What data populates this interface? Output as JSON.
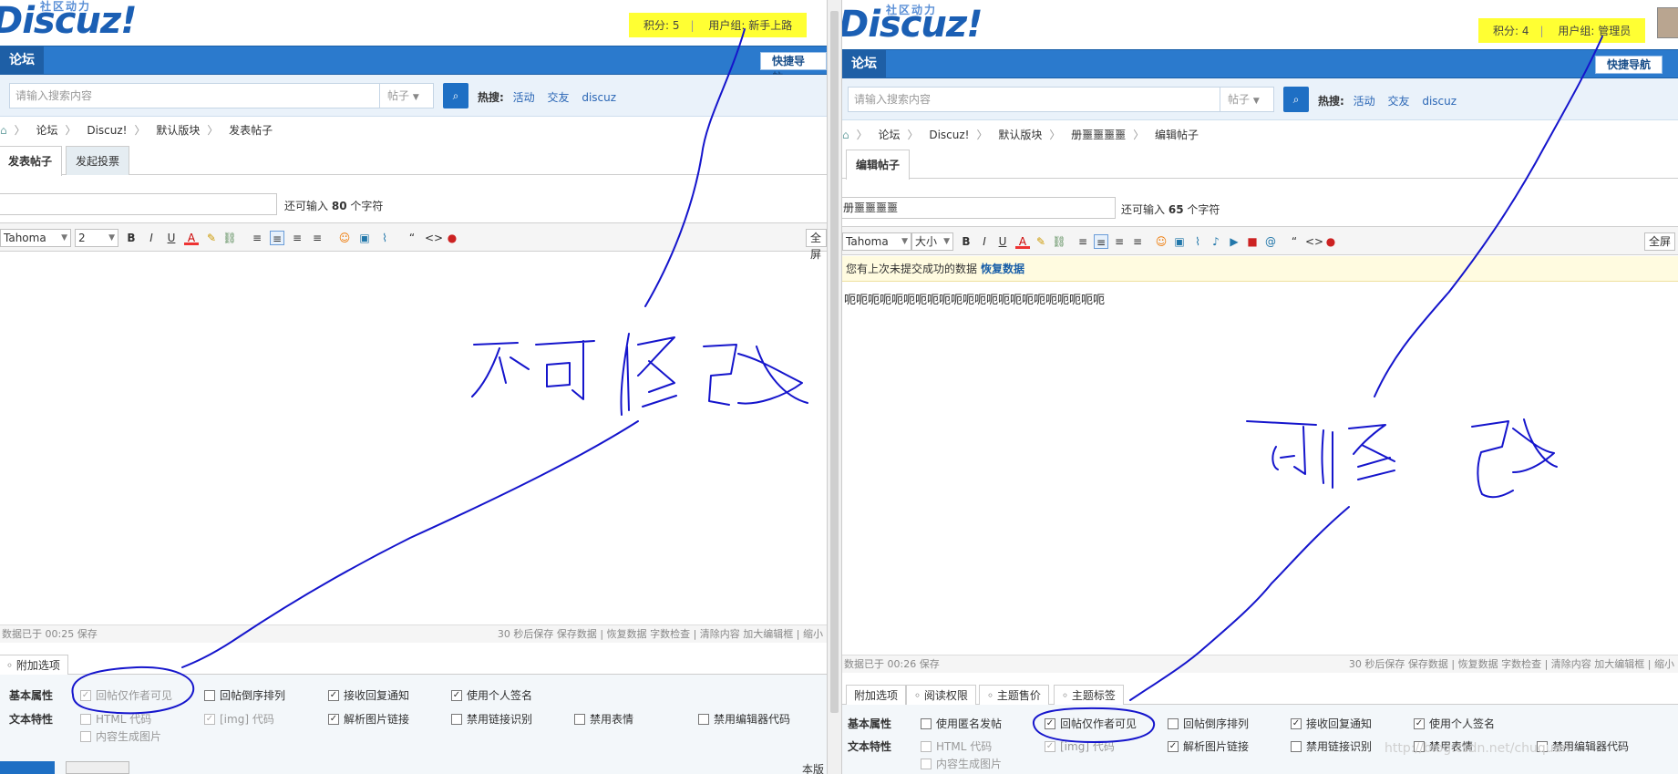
{
  "left": {
    "logo": "Discuz!",
    "logo_sub": "社区动力",
    "points_label": "积分: 5",
    "group_label": "用户组: 新手上路",
    "nav_tab": "论坛",
    "quick_nav": "快捷导航",
    "search_placeholder": "请输入搜索内容",
    "search_type": "帖子",
    "hot_label": "热搜:",
    "hot_links": [
      "活动",
      "交友",
      "discuz"
    ],
    "breadcrumb": [
      "论坛",
      "Discuz!",
      "默认版块",
      "发表帖子"
    ],
    "tabs": [
      "发表帖子",
      "发起投票"
    ],
    "title_value": "",
    "remain_prefix": "还可输入",
    "remain_count": "80",
    "remain_suffix": "个字符",
    "font_select": "Tahoma",
    "size_select": "2",
    "fullscreen": "全屏",
    "editor_content": "",
    "status_left": "数据已于 00:25 保存",
    "status_right": "30 秒后保存 保存数据 | 恢复数据    字数检查 | 清除内容    加大编辑框 | 缩小",
    "option_tabs": [
      "附加选项"
    ],
    "basic_label": "基本属性",
    "text_label": "文本特性",
    "basic_options": [
      {
        "label": "回帖仅作者可见",
        "checked": true,
        "disabled": true
      },
      {
        "label": "回帖倒序排列",
        "checked": false,
        "disabled": false
      },
      {
        "label": "接收回复通知",
        "checked": true,
        "disabled": false
      },
      {
        "label": "使用个人签名",
        "checked": true,
        "disabled": false
      }
    ],
    "text_options": [
      {
        "label": "HTML 代码",
        "checked": false,
        "disabled": true
      },
      {
        "label": "[img] 代码",
        "checked": true,
        "disabled": true
      },
      {
        "label": "解析图片链接",
        "checked": true,
        "disabled": false
      },
      {
        "label": "禁用链接识别",
        "checked": false,
        "disabled": false
      },
      {
        "label": "禁用表情",
        "checked": false,
        "disabled": false
      },
      {
        "label": "禁用编辑器代码",
        "checked": false,
        "disabled": false
      }
    ],
    "extra_option": {
      "label": "内容生成图片",
      "checked": false,
      "disabled": true
    },
    "bottom_right": "本版"
  },
  "right": {
    "logo": "Discuz!",
    "logo_sub": "社区动力",
    "points_label": "积分: 4",
    "group_label": "用户组: 管理员",
    "nav_tab": "论坛",
    "quick_nav": "快捷导航",
    "search_placeholder": "请输入搜索内容",
    "search_type": "帖子",
    "hot_label": "热搜:",
    "hot_links": [
      "活动",
      "交友",
      "discuz"
    ],
    "breadcrumb": [
      "论坛",
      "Discuz!",
      "默认版块",
      "册噩噩噩噩",
      "编辑帖子"
    ],
    "tabs": [
      "编辑帖子"
    ],
    "title_value": "册噩噩噩噩",
    "remain_prefix": "还可输入",
    "remain_count": "65",
    "remain_suffix": "个字符",
    "font_select": "Tahoma",
    "size_select": "大小",
    "fullscreen": "全屏",
    "notice_text": "您有上次未提交成功的数据",
    "notice_link": "恢复数据",
    "editor_content": "呃呃呃呃呃呃呃呃呃呃呃呃呃呃呃呃呃呃呃呃呃呃",
    "status_left": "数据已于 00:26 保存",
    "status_right": "30 秒后保存 保存数据 | 恢复数据    字数检查 | 清除内容    加大编辑框 | 缩小",
    "option_tabs": [
      "附加选项",
      "阅读权限",
      "主题售价",
      "主题标签"
    ],
    "basic_label": "基本属性",
    "text_label": "文本特性",
    "basic_options": [
      {
        "label": "使用匿名发帖",
        "checked": false,
        "disabled": false
      },
      {
        "label": "回帖仅作者可见",
        "checked": true,
        "disabled": false
      },
      {
        "label": "回帖倒序排列",
        "checked": false,
        "disabled": false
      },
      {
        "label": "接收回复通知",
        "checked": true,
        "disabled": false
      },
      {
        "label": "使用个人签名",
        "checked": true,
        "disabled": false
      }
    ],
    "text_options": [
      {
        "label": "HTML 代码",
        "checked": false,
        "disabled": true
      },
      {
        "label": "[img] 代码",
        "checked": true,
        "disabled": true
      },
      {
        "label": "解析图片链接",
        "checked": true,
        "disabled": false
      },
      {
        "label": "禁用链接识别",
        "checked": false,
        "disabled": false
      },
      {
        "label": "禁用表情",
        "checked": false,
        "disabled": false
      },
      {
        "label": "禁用编辑器代码",
        "checked": false,
        "disabled": false
      }
    ],
    "extra_option": {
      "label": "内容生成图片",
      "checked": false,
      "disabled": true
    },
    "watermark": "http://blog.csdn.net/chuquan"
  },
  "icons": {
    "bold": "B",
    "italic": "I",
    "underline": "U",
    "color": "A",
    "quote": "“",
    "code": "<>",
    "search": "⌕"
  },
  "colors": {
    "nav_blue": "#2b7acd",
    "highlight": "#ffff33",
    "annotation": "#1515cc"
  }
}
